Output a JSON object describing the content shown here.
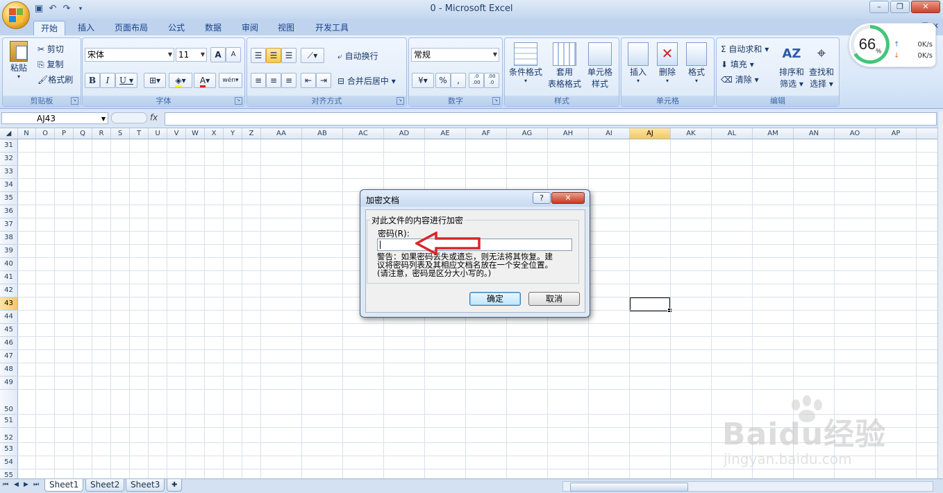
{
  "window": {
    "title": "0 - Microsoft Excel",
    "controls": [
      "–",
      "❐",
      "✕"
    ]
  },
  "ribbon_tabs": [
    {
      "label": "开始",
      "active": true
    },
    {
      "label": "插入"
    },
    {
      "label": "页面布局"
    },
    {
      "label": "公式"
    },
    {
      "label": "数据"
    },
    {
      "label": "审阅"
    },
    {
      "label": "视图"
    },
    {
      "label": "开发工具"
    }
  ],
  "clipboard": {
    "paste": "粘贴",
    "cut": "剪切",
    "copy": "复制",
    "format_painter": "格式刷",
    "label": "剪贴板"
  },
  "font": {
    "name": "宋体",
    "size": "11",
    "label": "字体",
    "bold": "B",
    "italic": "I",
    "underline": "U",
    "grow": "A",
    "shrink": "A",
    "phonetic": "wén"
  },
  "alignment": {
    "wrap_text": "自动换行",
    "merge_center": "合并后居中",
    "label": "对齐方式"
  },
  "number": {
    "format": "常规",
    "percent": "%",
    "comma": ",",
    "label": "数字",
    "dec_inc": ".0 .00",
    "dec_dec": ".00 .0"
  },
  "styles": {
    "conditional_line1": "条件格式",
    "table_line1": "套用",
    "table_line2": "表格格式",
    "cell_line1": "单元格",
    "cell_line2": "样式",
    "label": "样式"
  },
  "cells": {
    "insert": "插入",
    "delete": "删除",
    "format": "格式",
    "label": "单元格"
  },
  "editing": {
    "autosum": "自动求和",
    "fill": "填充",
    "clear": "清除",
    "sort_line1": "排序和",
    "sort_line2": "筛选",
    "find_line1": "查找和",
    "find_line2": "选择",
    "label": "编辑"
  },
  "net_widget": {
    "percent": "66",
    "percent_sign": "%",
    "up": "0K/s",
    "down": "0K/s"
  },
  "formula_bar": {
    "name_box": "AJ43",
    "fx": "fx",
    "value": ""
  },
  "columns": [
    "N",
    "O",
    "P",
    "Q",
    "R",
    "S",
    "T",
    "U",
    "V",
    "W",
    "X",
    "Y",
    "Z",
    "AA",
    "AB",
    "AC",
    "AD",
    "AE",
    "AF",
    "AG",
    "AH",
    "AI",
    "AJ",
    "AK",
    "AL",
    "AM",
    "AN",
    "AO",
    "AP"
  ],
  "rows": [
    "31",
    "32",
    "33",
    "34",
    "35",
    "36",
    "37",
    "38",
    "39",
    "40",
    "41",
    "42",
    "43",
    "44",
    "45",
    "46",
    "47",
    "48",
    "49",
    "50",
    "51",
    "52",
    "53",
    "54",
    "55"
  ],
  "selected_column": "AJ",
  "selected_row": "43",
  "sheets": [
    "Sheet1",
    "Sheet2",
    "Sheet3"
  ],
  "dialog": {
    "title": "加密文档",
    "help": "?",
    "close": "✕",
    "group_label": "对此文件的内容进行加密",
    "password_label": "密码(R):",
    "password_value": "",
    "warning_line1": "警告：如果密码丢失或遗忘，则无法将其恢复。建",
    "warning_line2": "议将密码列表及其相应文档名放在一个安全位置。",
    "warning_line3": "(请注意，密码是区分大小写的。)",
    "ok": "确定",
    "cancel": "取消"
  },
  "annotation": {
    "color": "#d9252a"
  },
  "watermark": {
    "main": "Baidu经验",
    "sub": "jingyan.baidu.com"
  }
}
